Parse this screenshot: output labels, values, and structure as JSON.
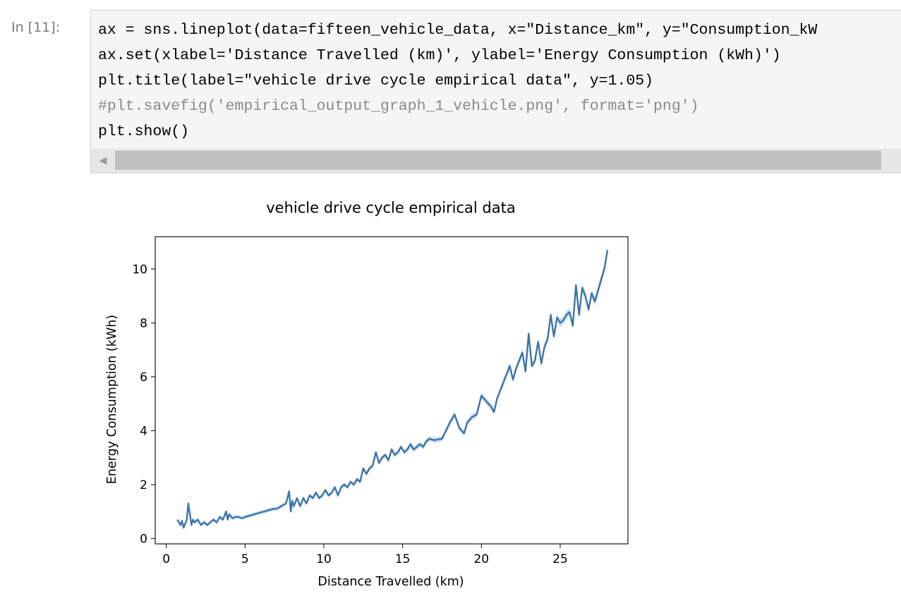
{
  "cell": {
    "prompt": "In [11]:",
    "code_lines": [
      "ax = sns.lineplot(data=fifteen_vehicle_data, x=\"Distance_km\", y=\"Consumption_kW",
      "ax.set(xlabel='Distance Travelled (km)', ylabel='Energy Consumption (kWh)')",
      "plt.title(label=\"vehicle drive cycle empirical data\", y=1.05)",
      "#plt.savefig('empirical_output_graph_1_vehicle.png', format='png')",
      "plt.show()"
    ]
  },
  "colors": {
    "line": "#3a75b0",
    "band": "#a9c4e2"
  },
  "chart_data": {
    "type": "line",
    "title": "vehicle drive cycle empirical data",
    "xlabel": "Distance Travelled (km)",
    "ylabel": "Energy Consumption (kWh)",
    "xlim": [
      -0.7,
      29.3
    ],
    "ylim": [
      -0.2,
      11.2
    ],
    "x_ticks": [
      0,
      5,
      10,
      15,
      20,
      25
    ],
    "y_ticks": [
      0,
      2,
      4,
      6,
      8,
      10
    ],
    "grid": false,
    "x": [
      0.7,
      0.9,
      1.0,
      1.1,
      1.3,
      1.4,
      1.6,
      1.7,
      1.8,
      2.0,
      2.2,
      2.4,
      2.6,
      2.8,
      3.0,
      3.2,
      3.4,
      3.6,
      3.8,
      3.9,
      4.0,
      4.2,
      4.4,
      4.6,
      4.8,
      5.0,
      5.3,
      5.6,
      5.9,
      6.2,
      6.5,
      6.8,
      7.0,
      7.3,
      7.6,
      7.8,
      7.9,
      8.0,
      8.1,
      8.3,
      8.5,
      8.7,
      8.9,
      9.1,
      9.3,
      9.5,
      9.7,
      9.9,
      10.1,
      10.3,
      10.5,
      10.7,
      10.9,
      11.1,
      11.3,
      11.5,
      11.7,
      11.9,
      12.1,
      12.3,
      12.5,
      12.7,
      12.9,
      13.1,
      13.3,
      13.5,
      13.7,
      13.9,
      14.1,
      14.3,
      14.5,
      14.7,
      14.9,
      15.1,
      15.3,
      15.5,
      15.7,
      15.9,
      16.1,
      16.3,
      16.5,
      16.7,
      17.0,
      17.5,
      18.0,
      18.3,
      18.6,
      18.9,
      19.1,
      19.4,
      19.7,
      20.0,
      20.3,
      20.6,
      20.8,
      21.0,
      21.2,
      21.4,
      21.6,
      21.8,
      22.0,
      22.2,
      22.4,
      22.6,
      22.8,
      23.0,
      23.2,
      23.4,
      23.6,
      23.8,
      24.0,
      24.2,
      24.4,
      24.6,
      24.8,
      25.0,
      25.2,
      25.4,
      25.6,
      25.8,
      26.0,
      26.2,
      26.4,
      26.6,
      26.8,
      27.0,
      27.2,
      27.4,
      27.6,
      27.8,
      28.0
    ],
    "y": [
      0.7,
      0.5,
      0.65,
      0.4,
      0.7,
      1.3,
      0.5,
      0.7,
      0.6,
      0.7,
      0.5,
      0.6,
      0.5,
      0.6,
      0.7,
      0.6,
      0.8,
      0.7,
      1.0,
      0.7,
      0.9,
      0.75,
      0.8,
      0.8,
      0.75,
      0.8,
      0.85,
      0.9,
      0.95,
      1.0,
      1.05,
      1.1,
      1.1,
      1.2,
      1.3,
      1.75,
      1.0,
      1.4,
      1.2,
      1.5,
      1.2,
      1.5,
      1.3,
      1.6,
      1.5,
      1.7,
      1.5,
      1.6,
      1.8,
      1.6,
      1.7,
      1.9,
      1.6,
      1.9,
      2.0,
      1.9,
      2.1,
      2.0,
      2.2,
      2.1,
      2.6,
      2.4,
      2.6,
      2.7,
      3.2,
      2.8,
      3.0,
      3.1,
      2.9,
      3.3,
      3.1,
      3.2,
      3.4,
      3.2,
      3.3,
      3.5,
      3.3,
      3.4,
      3.5,
      3.4,
      3.6,
      3.7,
      3.65,
      3.7,
      4.3,
      4.6,
      4.1,
      3.9,
      4.3,
      4.5,
      4.6,
      5.3,
      5.1,
      4.9,
      4.7,
      5.2,
      5.5,
      5.8,
      6.1,
      6.4,
      5.9,
      6.3,
      6.6,
      6.9,
      6.2,
      7.6,
      6.4,
      6.6,
      7.3,
      6.5,
      7.1,
      7.4,
      8.3,
      7.5,
      8.2,
      8.0,
      8.1,
      8.3,
      8.4,
      7.9,
      9.4,
      8.3,
      9.3,
      9.0,
      8.5,
      9.1,
      8.8,
      9.2,
      9.6,
      10.0,
      10.7
    ]
  }
}
